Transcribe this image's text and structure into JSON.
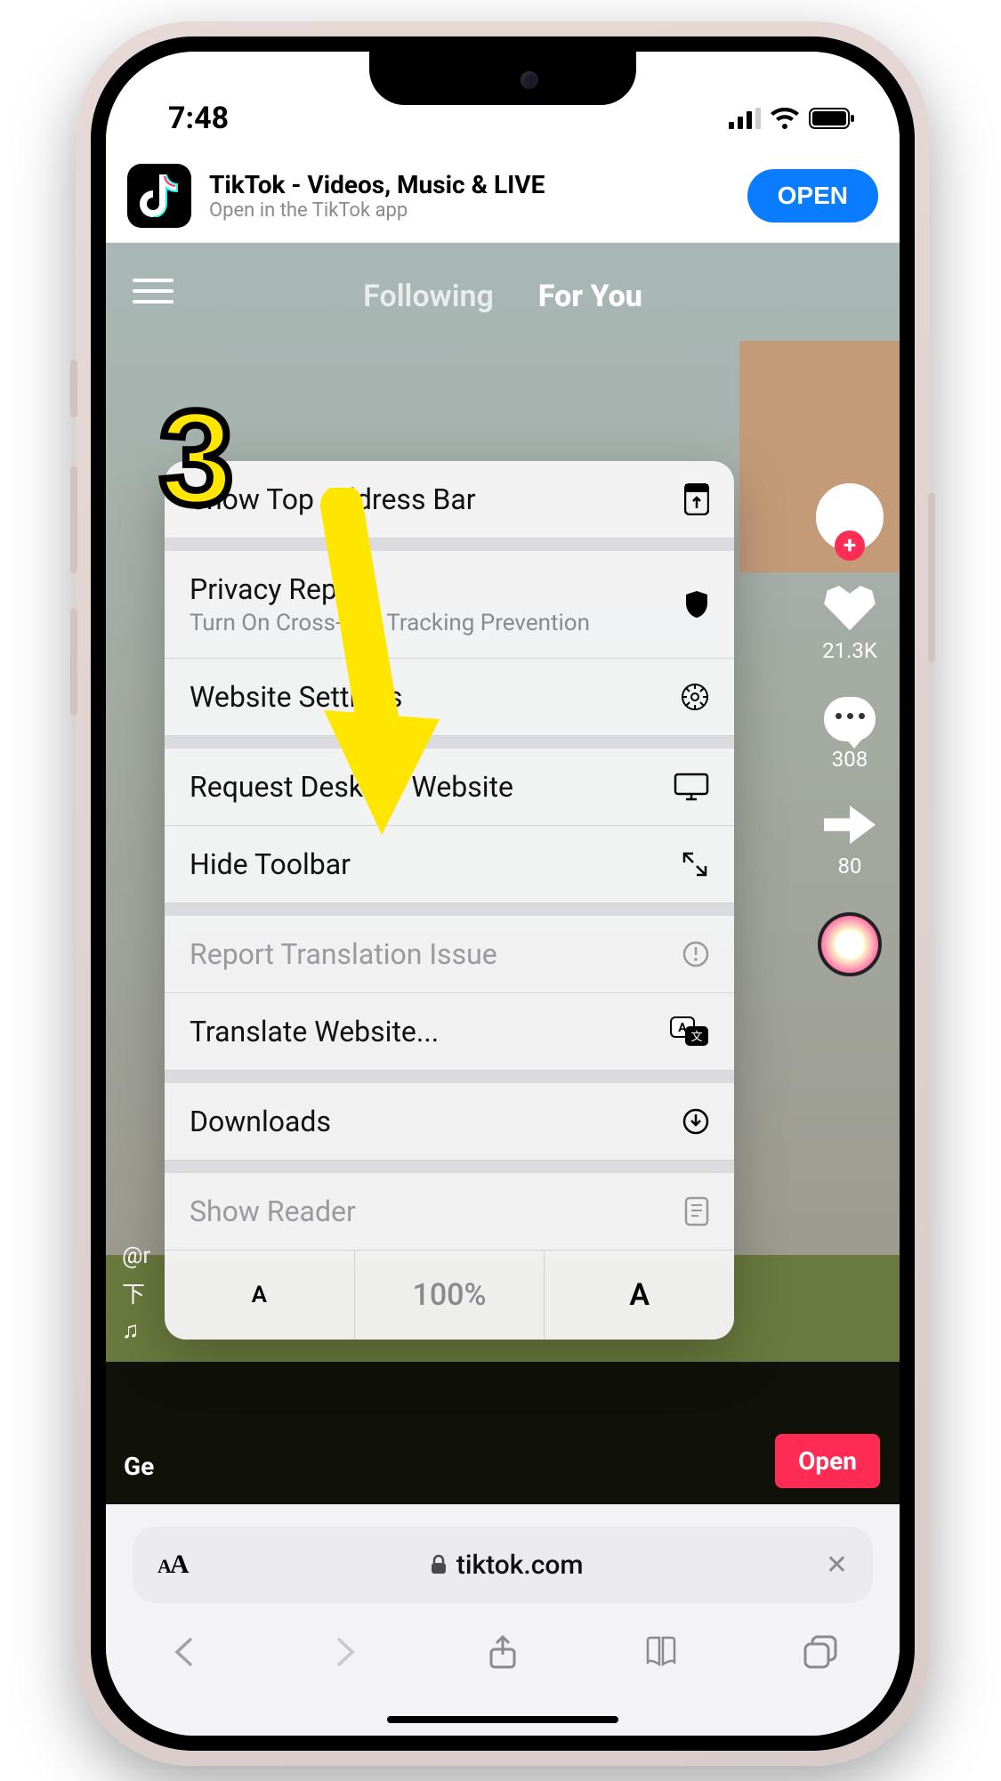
{
  "status": {
    "time": "7:48"
  },
  "banner": {
    "title": "TikTok - Videos, Music & LIVE",
    "subtitle": "Open in the TikTok app",
    "button": "OPEN"
  },
  "nav": {
    "following": "Following",
    "foryou": "For You"
  },
  "rail": {
    "likes": "21.3K",
    "comments": "308",
    "shares": "80"
  },
  "meta": {
    "handle": "@r",
    "line2": "下",
    "music": "♫"
  },
  "bottom_bar": {
    "left": "Ge",
    "open": "Open"
  },
  "menu": {
    "show_top": "Show Top Address Bar",
    "privacy": "Privacy Report",
    "privacy_sub": "Turn On Cross-Site Tracking Prevention",
    "settings": "Website Settings",
    "desktop": "Request Desktop Website",
    "hide_toolbar": "Hide Toolbar",
    "report_translation": "Report Translation Issue",
    "translate": "Translate Website...",
    "downloads": "Downloads",
    "show_reader": "Show Reader",
    "zoom": "100%"
  },
  "address_bar": {
    "domain": "tiktok.com"
  },
  "annotation": {
    "step": "3"
  }
}
